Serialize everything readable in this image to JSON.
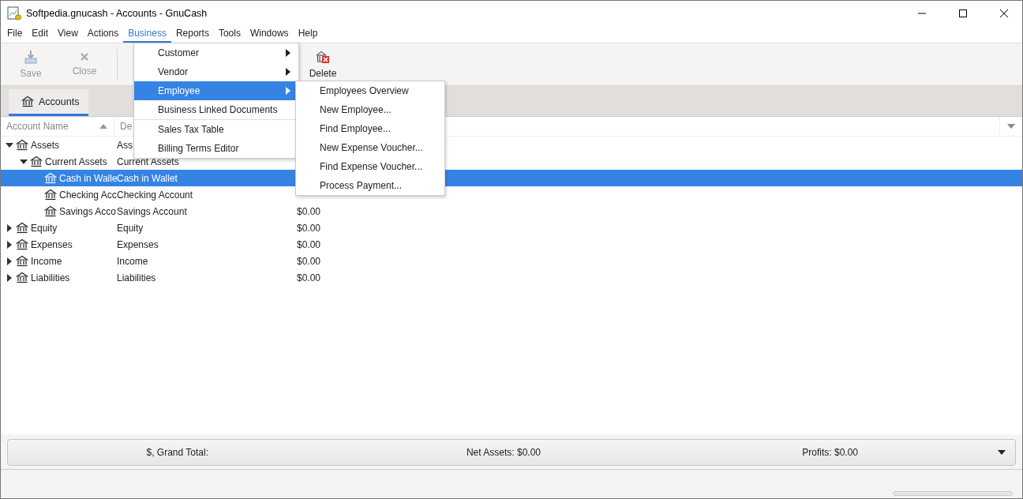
{
  "window": {
    "title": "Softpedia.gnucash - Accounts - GnuCash"
  },
  "menubar": [
    {
      "label": "File",
      "selected": false
    },
    {
      "label": "Edit",
      "selected": false
    },
    {
      "label": "View",
      "selected": false
    },
    {
      "label": "Actions",
      "selected": false
    },
    {
      "label": "Business",
      "selected": true
    },
    {
      "label": "Reports",
      "selected": false
    },
    {
      "label": "Tools",
      "selected": false
    },
    {
      "label": "Windows",
      "selected": false
    },
    {
      "label": "Help",
      "selected": false
    }
  ],
  "toolbar": [
    {
      "kind": "save",
      "label": "Save",
      "disabled": true
    },
    {
      "kind": "close",
      "label": "Close",
      "disabled": true
    },
    {
      "kind": "separator"
    },
    {
      "kind": "delete",
      "label": "Delete",
      "disabled": false
    }
  ],
  "tabs": [
    {
      "label": "Accounts",
      "selected": true
    }
  ],
  "table": {
    "columns": [
      "Account Name",
      "De"
    ],
    "rows": [
      {
        "name": "Assets",
        "description": "Ass",
        "expanded": true,
        "selected": false,
        "children": [
          {
            "name": "Current Assets",
            "description": "Current Assets",
            "expanded": true,
            "selected": false,
            "children": [
              {
                "name": "Cash in Walle",
                "description": "Cash in Wallet",
                "selected": true
              },
              {
                "name": "Checking Acc",
                "description": "Checking Account",
                "selected": false
              },
              {
                "name": "Savings Acco",
                "description": "Savings Account",
                "total": "$0.00",
                "selected": false
              }
            ]
          }
        ]
      },
      {
        "name": "Equity",
        "description": "Equity",
        "total": "$0.00",
        "expanded": false,
        "selected": false
      },
      {
        "name": "Expenses",
        "description": "Expenses",
        "total": "$0.00",
        "expanded": false,
        "selected": false
      },
      {
        "name": "Income",
        "description": "Income",
        "total": "$0.00",
        "expanded": false,
        "selected": false
      },
      {
        "name": "Liabilities",
        "description": "Liabilities",
        "total": "$0.00",
        "expanded": false,
        "selected": false
      }
    ]
  },
  "summary_bar": {
    "grand_total": "$, Grand Total:",
    "net_assets": "Net Assets: $0.00",
    "profits": "Profits: $0.00"
  },
  "status_bar": {
    "progress": {
      "level": 0
    }
  },
  "business_menu": [
    {
      "kind": "item",
      "label": "Customer",
      "submenu": true,
      "selected": false
    },
    {
      "kind": "item",
      "label": "Vendor",
      "submenu": true,
      "selected": false
    },
    {
      "kind": "item",
      "label": "Employee",
      "submenu": true,
      "selected": true
    },
    {
      "kind": "item",
      "label": "Business Linked Documents",
      "submenu": false,
      "selected": false
    },
    {
      "kind": "separator"
    },
    {
      "kind": "item",
      "label": "Sales Tax Table",
      "submenu": false,
      "selected": false
    },
    {
      "kind": "item",
      "label": "Billing Terms Editor",
      "submenu": false,
      "selected": false
    }
  ],
  "employee_menu": [
    {
      "label": "Employees Overview"
    },
    {
      "label": "New Employee..."
    },
    {
      "label": "Find Employee..."
    },
    {
      "label": "New Expense Voucher..."
    },
    {
      "label": "Find Expense Voucher..."
    },
    {
      "label": "Process Payment..."
    }
  ]
}
